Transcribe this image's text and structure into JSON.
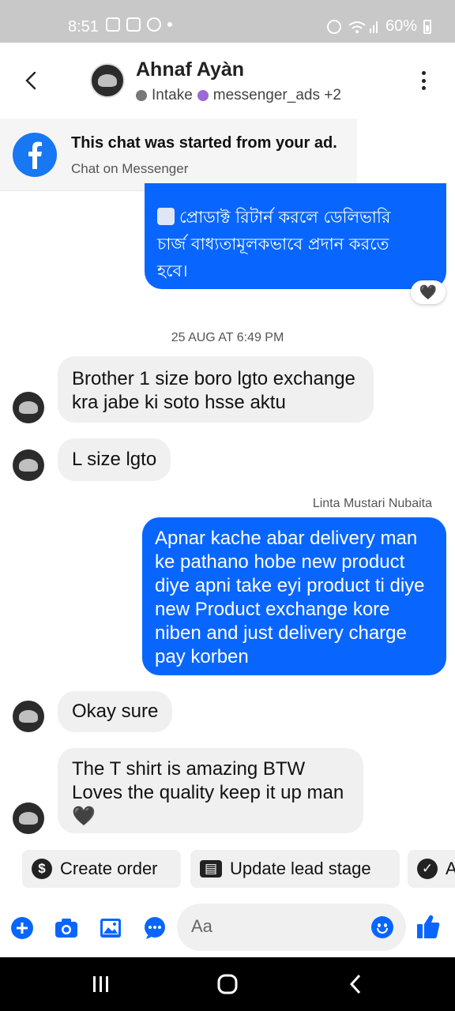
{
  "status_bar": {
    "time": "8:51",
    "battery": "60%"
  },
  "header": {
    "contact_name": "Ahnaf Ayàn",
    "labels": [
      "Intake",
      "messenger_ads +2"
    ],
    "label_colors": [
      "#777777",
      "#9a6ad6"
    ]
  },
  "ad_banner": {
    "title": "This chat was started from your ad.",
    "subtitle": "Chat on Messenger"
  },
  "messages": {
    "m0": {
      "text_line1": "প্রোডাক্ট রিটার্ন করলে ডেলিভারি",
      "text_line2": "চার্জ বাধ্যতামূলকভাবে প্রদান করতে",
      "text_line3": "হবে।",
      "reaction": "🖤"
    },
    "timestamp": "25 AUG AT 6:49 PM",
    "m1": {
      "line1": "Brother 1 size boro lgto exchange",
      "line2": "kra jabe ki soto hsse aktu"
    },
    "m2": {
      "text": "L size lgto"
    },
    "sender_label": "Linta Mustari Nubaita",
    "m3": {
      "lines": [
        "Apnar kache abar delivery man",
        "ke pathano hobe new product",
        "diye apni take eyi product ti diye",
        "new Product exchange kore",
        "niben and just delivery charge",
        "pay korben"
      ]
    },
    "m4": {
      "text": "Okay sure"
    },
    "m5": {
      "line1": "The T shirt is amazing BTW",
      "line2": "Loves the quality keep it up man",
      "line3": "🖤"
    }
  },
  "quick_actions": {
    "create_order": "Create order",
    "update_lead_stage": "Update lead stage",
    "third": "A"
  },
  "composer": {
    "placeholder": "Aa"
  },
  "colors": {
    "accent": "#0866ff",
    "incoming_bubble": "#f0f0f0"
  }
}
